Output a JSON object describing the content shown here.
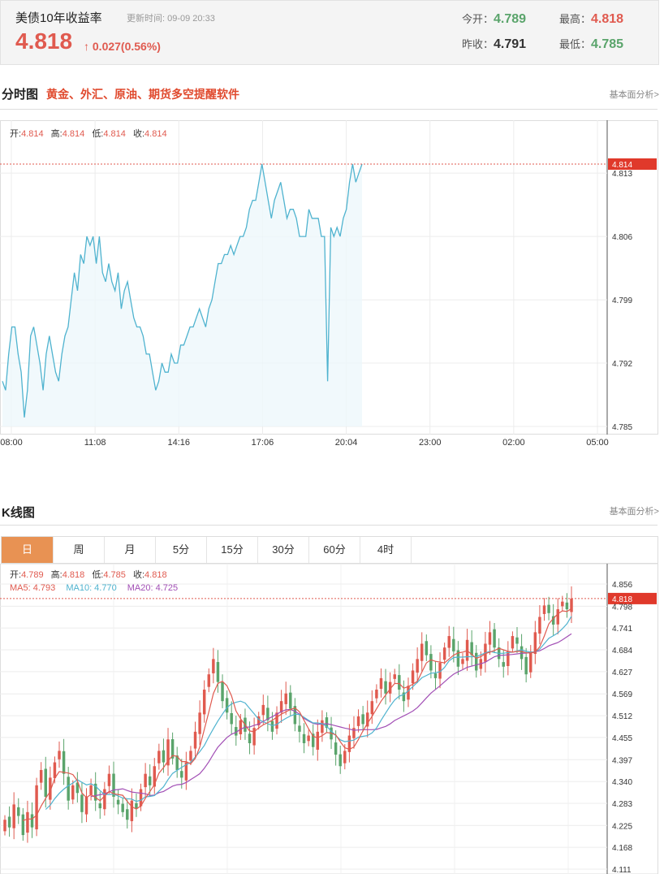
{
  "header": {
    "title": "美债10年收益率",
    "update_label": "更新时间: 09-09 20:33",
    "price": "4.818",
    "change": "0.027(0.56%)",
    "open_label": "今开：",
    "open_value": "4.789",
    "prev_close_label": "昨收：",
    "prev_close_value": "4.791",
    "high_label": "最高：",
    "high_value": "4.818",
    "low_label": "最低：",
    "low_value": "4.785"
  },
  "intraday_section": {
    "title": "分时图",
    "subtitle": "黄金、外汇、原油、期货多空提醒软件",
    "link": "基本面分析>"
  },
  "kline_section": {
    "title": "K线图",
    "link": "基本面分析>",
    "tabs": [
      "日",
      "周",
      "月",
      "5分",
      "15分",
      "30分",
      "60分",
      "4时"
    ],
    "active_tab": "日"
  },
  "colors": {
    "up": "#e05a4f",
    "down": "#5aa46b",
    "intraday_line": "#4fb3cf",
    "ma5": "#e05a4f",
    "ma10": "#4fb3cf",
    "ma20": "#a24fb5",
    "tab_active": "#e89253"
  },
  "chart_data": [
    {
      "type": "line",
      "ohlc_labels": {
        "open_label": "开:",
        "open": "4.814",
        "high_label": "高:",
        "high": "4.814",
        "low_label": "低:",
        "low": "4.814",
        "close_label": "收:",
        "close": "4.814"
      },
      "last_price_label": "4.814",
      "x_ticks": [
        "08:00",
        "11:08",
        "14:16",
        "17:06",
        "20:04",
        "23:00",
        "02:00",
        "05:00"
      ],
      "y_ticks": [
        "4.813",
        "4.806",
        "4.799",
        "4.792",
        "4.785"
      ],
      "ylim": [
        4.785,
        4.814
      ],
      "values": [
        4.79,
        4.789,
        4.793,
        4.796,
        4.796,
        4.793,
        4.791,
        4.786,
        4.789,
        4.795,
        4.796,
        4.794,
        4.792,
        4.789,
        4.793,
        4.795,
        4.793,
        4.791,
        4.79,
        4.793,
        4.795,
        4.796,
        4.799,
        4.802,
        4.8,
        4.804,
        4.803,
        4.806,
        4.805,
        4.806,
        4.803,
        4.806,
        4.802,
        4.801,
        4.803,
        4.801,
        4.8,
        4.802,
        4.798,
        4.8,
        4.801,
        4.799,
        4.797,
        4.796,
        4.796,
        4.795,
        4.793,
        4.793,
        4.791,
        4.789,
        4.79,
        4.792,
        4.791,
        4.791,
        4.793,
        4.792,
        4.792,
        4.794,
        4.794,
        4.795,
        4.796,
        4.796,
        4.797,
        4.798,
        4.797,
        4.796,
        4.798,
        4.799,
        4.801,
        4.803,
        4.803,
        4.804,
        4.804,
        4.805,
        4.804,
        4.805,
        4.806,
        4.806,
        4.807,
        4.809,
        4.81,
        4.81,
        4.812,
        4.814,
        4.812,
        4.81,
        4.808,
        4.81,
        4.811,
        4.812,
        4.81,
        4.808,
        4.809,
        4.809,
        4.808,
        4.806,
        4.806,
        4.806,
        4.809,
        4.808,
        4.808,
        4.808,
        4.806,
        4.806,
        4.79,
        4.807,
        4.806,
        4.807,
        4.806,
        4.808,
        4.809,
        4.812,
        4.814,
        4.812,
        4.813,
        4.814
      ]
    },
    {
      "type": "candlestick",
      "ohlc_labels": {
        "open_label": "开:",
        "open": "4.789",
        "high_label": "高:",
        "high": "4.818",
        "low_label": "低:",
        "low": "4.785",
        "close_label": "收:",
        "close": "4.818"
      },
      "ma_labels": {
        "ma5": "MA5: 4.793",
        "ma10": "MA10: 4.770",
        "ma20": "MA20: 4.725"
      },
      "last_price_label": "4.818",
      "y_ticks": [
        "4.856",
        "4.798",
        "4.741",
        "4.684",
        "4.627",
        "4.569",
        "4.512",
        "4.455",
        "4.397",
        "4.340",
        "4.283",
        "4.225",
        "4.168",
        "4.111"
      ],
      "ylim": [
        4.111,
        4.856
      ],
      "closes": [
        4.24,
        4.22,
        4.28,
        4.25,
        4.2,
        4.26,
        4.22,
        4.33,
        4.37,
        4.3,
        4.35,
        4.39,
        4.42,
        4.36,
        4.29,
        4.33,
        4.31,
        4.26,
        4.3,
        4.33,
        4.29,
        4.27,
        4.32,
        4.36,
        4.3,
        4.28,
        4.26,
        4.24,
        4.29,
        4.27,
        4.32,
        4.36,
        4.33,
        4.38,
        4.42,
        4.39,
        4.45,
        4.4,
        4.37,
        4.35,
        4.39,
        4.42,
        4.47,
        4.52,
        4.58,
        4.62,
        4.66,
        4.6,
        4.55,
        4.52,
        4.49,
        4.46,
        4.5,
        4.47,
        4.44,
        4.48,
        4.51,
        4.54,
        4.5,
        4.47,
        4.52,
        4.55,
        4.57,
        4.53,
        4.49,
        4.47,
        4.44,
        4.46,
        4.43,
        4.47,
        4.5,
        4.48,
        4.45,
        4.41,
        4.38,
        4.42,
        4.46,
        4.48,
        4.51,
        4.49,
        4.52,
        4.55,
        4.58,
        4.61,
        4.57,
        4.6,
        4.62,
        4.58,
        4.55,
        4.59,
        4.63,
        4.66,
        4.7,
        4.67,
        4.63,
        4.61,
        4.65,
        4.69,
        4.72,
        4.68,
        4.64,
        4.66,
        4.71,
        4.67,
        4.63,
        4.66,
        4.7,
        4.73,
        4.69,
        4.66,
        4.64,
        4.68,
        4.72,
        4.7,
        4.66,
        4.62,
        4.68,
        4.73,
        4.77,
        4.8,
        4.78,
        4.75,
        4.79,
        4.81,
        4.79,
        4.818
      ]
    }
  ]
}
